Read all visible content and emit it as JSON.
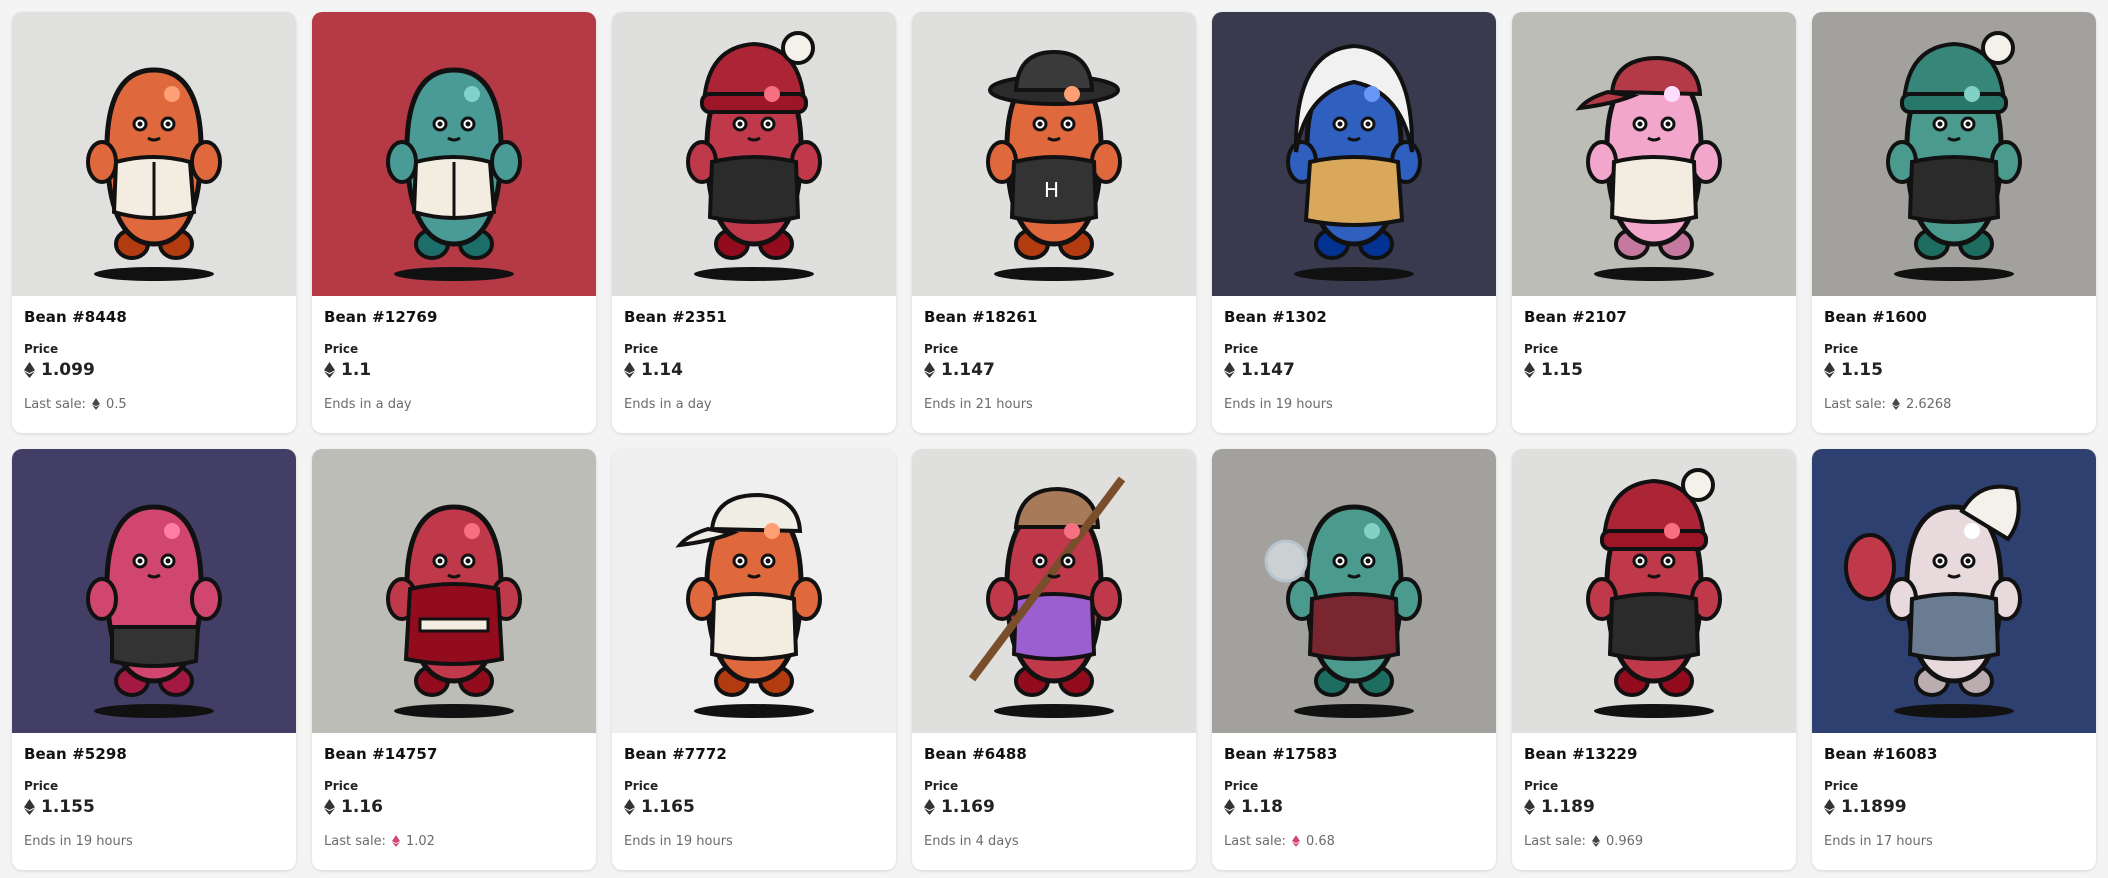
{
  "price_label": "Price",
  "last_sale_label": "Last sale:",
  "items": [
    {
      "name": "Bean #8448",
      "price": "1.099",
      "status": "",
      "last_sale": "0.5",
      "bg": "#e0e0df",
      "body": "#e0683d",
      "outfit": "vest",
      "eth_color": "#444"
    },
    {
      "name": "Bean #12769",
      "price": "1.1",
      "status": "Ends in a day",
      "last_sale": "",
      "bg": "#b53a46",
      "body": "#4a9a96",
      "outfit": "vest",
      "eth_color": "#444"
    },
    {
      "name": "Bean #2351",
      "price": "1.14",
      "status": "Ends in a day",
      "last_sale": "",
      "bg": "#dfdfde",
      "body": "#c0394b",
      "outfit": "beanie",
      "eth_color": "#444"
    },
    {
      "name": "Bean #18261",
      "price": "1.147",
      "status": "Ends in 21 hours",
      "last_sale": "",
      "bg": "#dfdfde",
      "body": "#e0683d",
      "outfit": "hat",
      "eth_color": "#444"
    },
    {
      "name": "Bean #1302",
      "price": "1.147",
      "status": "Ends in 19 hours",
      "last_sale": "",
      "bg": "#3a3a4e",
      "body": "#2f5fbf",
      "outfit": "hoodie",
      "eth_color": "#444"
    },
    {
      "name": "Bean #2107",
      "price": "1.15",
      "status": "",
      "last_sale": "",
      "bg": "#bcbdb7",
      "body": "#f2a6cc",
      "outfit": "cap",
      "eth_color": "#444"
    },
    {
      "name": "Bean #1600",
      "price": "1.15",
      "status": "",
      "last_sale": "2.6268",
      "bg": "#a2a19d",
      "body": "#4a9a8e",
      "outfit": "beanie",
      "eth_color": "#444"
    },
    {
      "name": "Bean #5298",
      "price": "1.155",
      "status": "Ends in 19 hours",
      "last_sale": "",
      "bg": "#433e66",
      "body": "#d0466f",
      "outfit": "pants",
      "eth_color": "#444"
    },
    {
      "name": "Bean #14757",
      "price": "1.16",
      "status": "",
      "last_sale": "1.02",
      "bg": "#bcbdb7",
      "body": "#c0394b",
      "outfit": "robe",
      "eth_color": "#d0466f"
    },
    {
      "name": "Bean #7772",
      "price": "1.165",
      "status": "Ends in 19 hours",
      "last_sale": "",
      "bg": "#eeefee",
      "body": "#e0683d",
      "outfit": "cap",
      "eth_color": "#444"
    },
    {
      "name": "Bean #6488",
      "price": "1.169",
      "status": "Ends in 4 days",
      "last_sale": "",
      "bg": "#dfdfde",
      "body": "#c0394b",
      "outfit": "sloth",
      "eth_color": "#444"
    },
    {
      "name": "Bean #17583",
      "price": "1.18",
      "status": "",
      "last_sale": "0.68",
      "bg": "#a2a19d",
      "body": "#4a9a8e",
      "outfit": "shirt",
      "eth_color": "#d0466f"
    },
    {
      "name": "Bean #13229",
      "price": "1.189",
      "status": "",
      "last_sale": "0.969",
      "bg": "#dfdfde",
      "body": "#c0394b",
      "outfit": "beanie",
      "eth_color": "#444"
    },
    {
      "name": "Bean #16083",
      "price": "1.1899",
      "status": "Ends in 17 hours",
      "last_sale": "",
      "bg": "#2e4070",
      "body": "#e8d9dd",
      "outfit": "kitsune",
      "eth_color": "#444"
    }
  ]
}
